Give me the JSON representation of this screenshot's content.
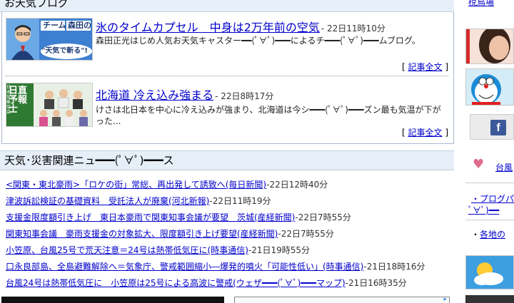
{
  "blog": {
    "header": "お天気ブログ",
    "entries": [
      {
        "title": "氷のタイムカプセル　中身は2万年前の空気",
        "time": "- 22日11時10分",
        "desc": "森田正光はじめ人気お天気キャスター━━(ﾟ∀ﾟ)━━━によるチ━━━(ﾟ∀ﾟ)━━━ムブログ。",
        "thumb": {
          "team": "チーム",
          "name": "森田の",
          "slogan": "\"天気で斬る\"!"
        }
      },
      {
        "title": "北海道 冷え込み強まる",
        "time": "- 22日8時17分",
        "desc": "けさは北日本を中心に冷え込みが強まり、北海道は今シ━━━(ﾟ∀ﾟ)━━━ズン最も気温が下がった...",
        "thumb": {
          "big": "日直予報士",
          "org": "日本気象協会"
        }
      }
    ],
    "more_prefix": "[",
    "more_label": "記事全文",
    "more_suffix": "]"
  },
  "news": {
    "header": "天気･災害関連ニュ━━━(ﾟ∀ﾟ)━━━ス",
    "items": [
      {
        "link": "<関東・東北豪雨>「ロケの街」常総、再出発して誘致へ(毎日新聞)",
        "time": "-22日12時40分"
      },
      {
        "link": "津波訴訟検証の基礎資料　受託法人が廃棄(河北新報)",
        "time": "-22日11時19分"
      },
      {
        "link": "支援金限度額引き上げ　東日本豪雨で関東知事会議が要望　茨城(産経新聞)",
        "time": "-22日7時55分"
      },
      {
        "link": "関東知事会議　豪雨支援金の対象拡大、限度額引き上げ要望(産経新聞)",
        "time": "-22日7時55分"
      },
      {
        "link": "小笠原、台風25号で荒天注意＝24号は熱帯低気圧に(時事通信)",
        "time": "-21日19時55分"
      },
      {
        "link": "口永良部島、全島避難解除へ＝気象庁、警戒範囲縮小―爆発的噴火「可能性低い」(時事通信)",
        "time": "-21日18時16分"
      },
      {
        "link": "台風24号は熱帯低気圧に　小笠原は25号による高波に警戒(ウェザ━━━(ﾟ∀ﾟ)━━━マップ)",
        "time": "-21日16時35分"
      }
    ]
  },
  "side": {
    "top_link": "梲鳥場",
    "fb_letter": "f",
    "typhoon_link": "台風",
    "blog_text": "・プログパ",
    "blog_text2": "ﾟ∀ﾟ)━━",
    "local_text": "・",
    "local_link": "各地の"
  },
  "colors": {
    "link": "#0000cc",
    "header_bg": "#e6eef8",
    "border": "#aab7cc"
  }
}
